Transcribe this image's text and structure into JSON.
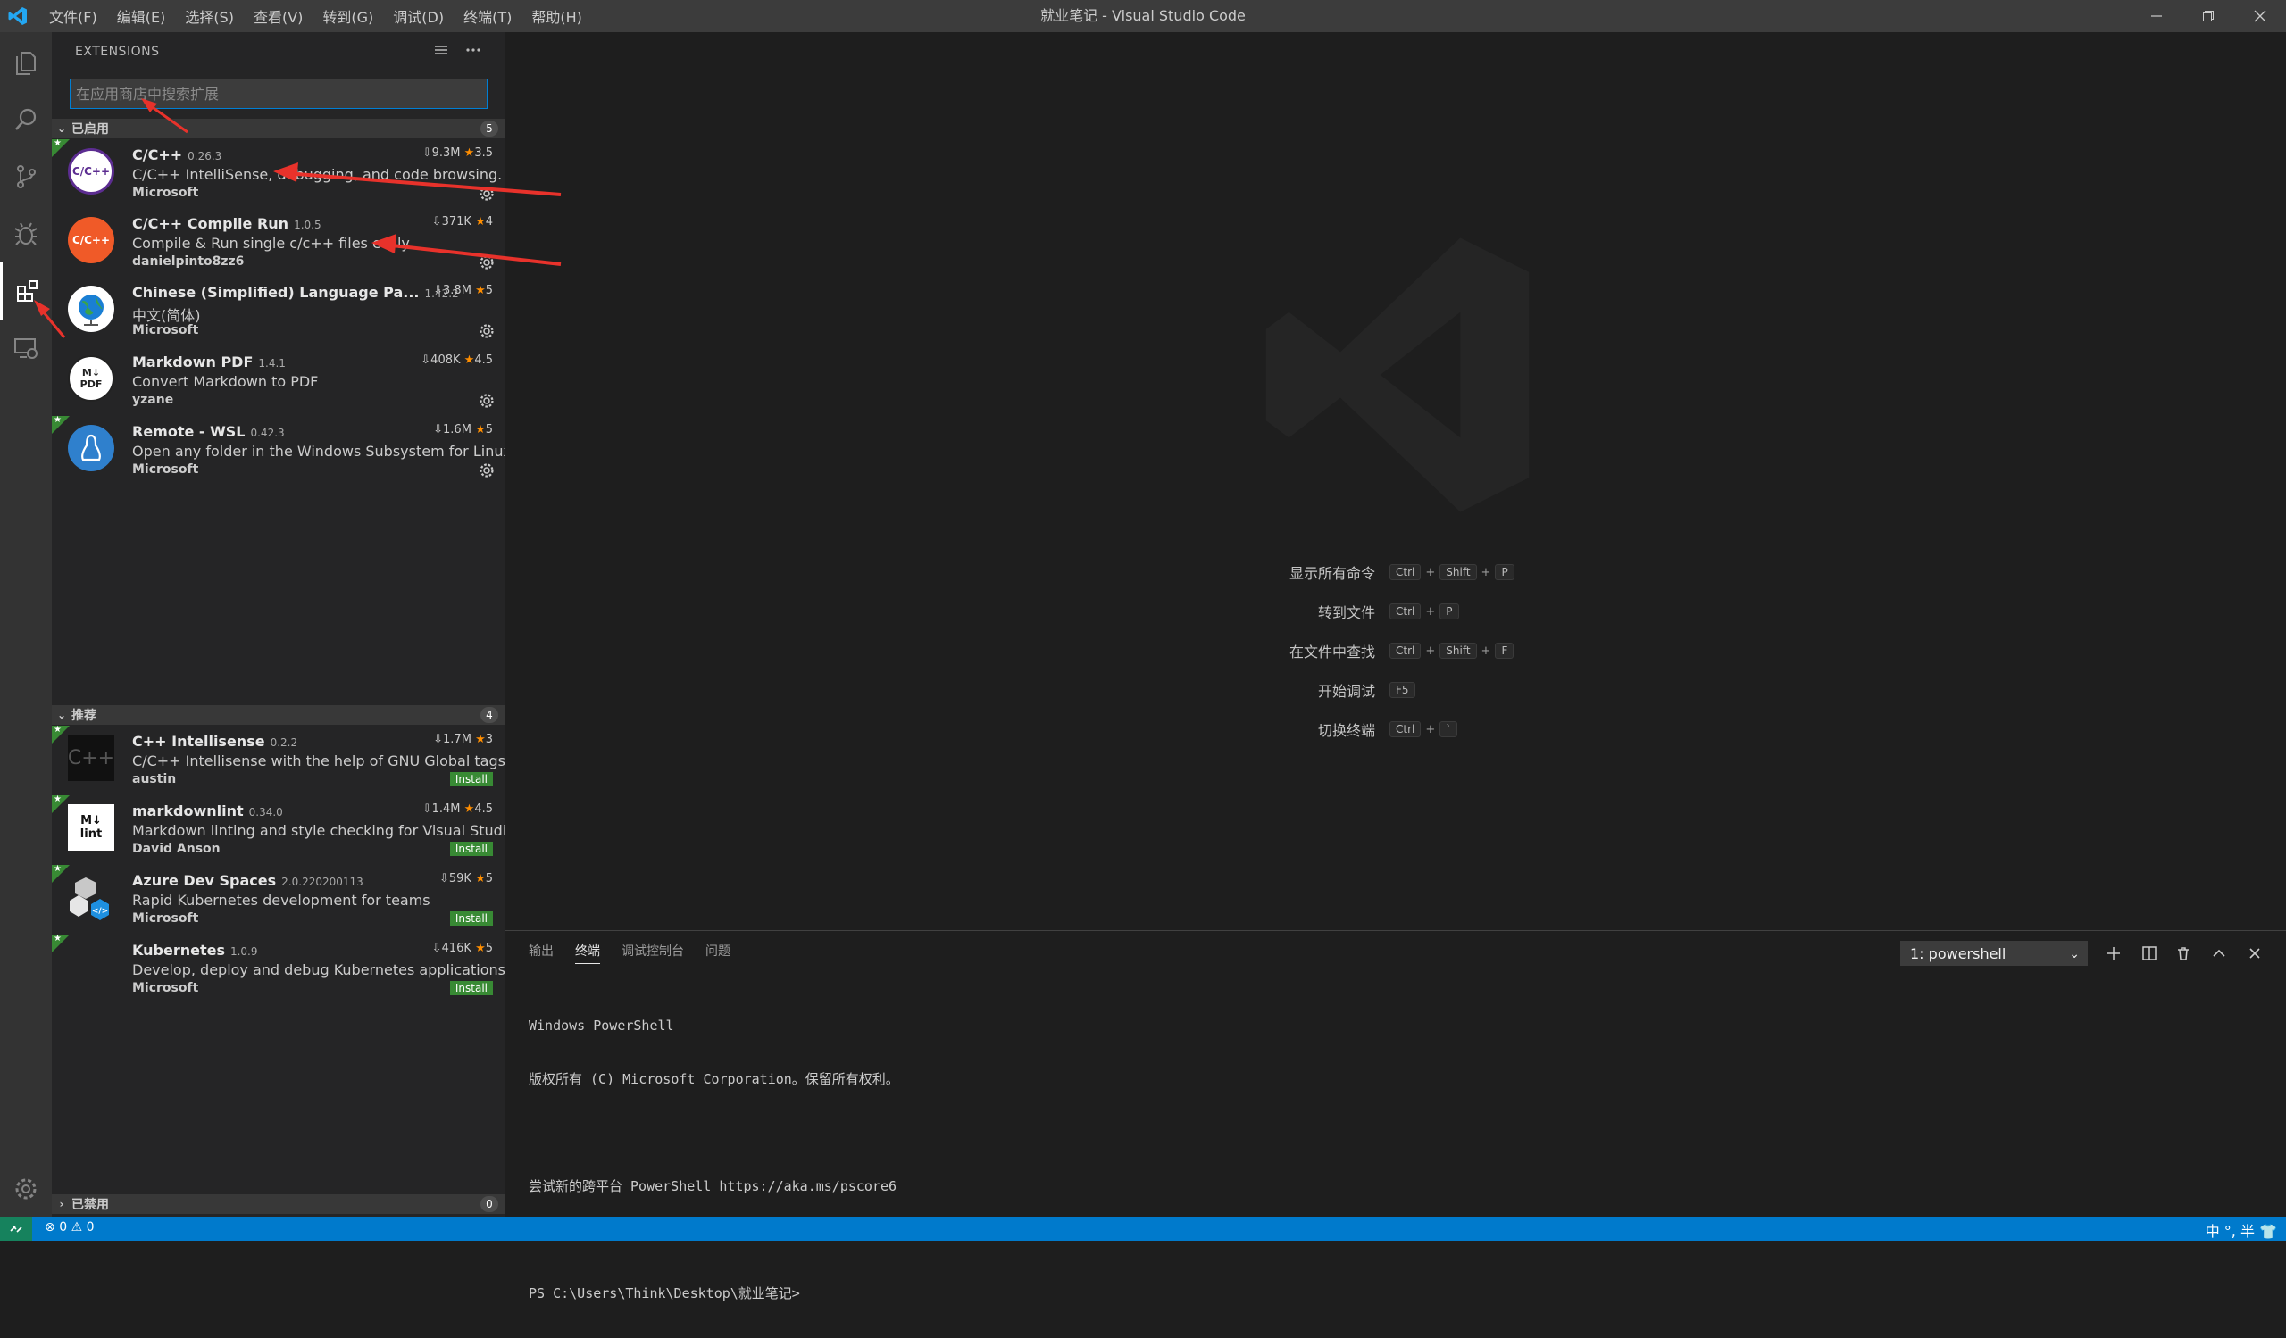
{
  "window": {
    "title": "就业笔记 - Visual Studio Code",
    "menu": [
      "文件(F)",
      "编辑(E)",
      "选择(S)",
      "查看(V)",
      "转到(G)",
      "调试(D)",
      "终端(T)",
      "帮助(H)"
    ]
  },
  "sidebar": {
    "title": "EXTENSIONS",
    "search_placeholder": "在应用商店中搜索扩展",
    "enabled_section": {
      "label": "已启用",
      "count": "5"
    },
    "recommended_section": {
      "label": "推荐",
      "count": "4"
    },
    "disabled_section": {
      "label": "已禁用",
      "count": "0"
    },
    "enabled": [
      {
        "name": "C/C++",
        "version": "0.26.3",
        "downloads": "9.3M",
        "rating": "3.5",
        "description": "C/C++ IntelliSense, debugging, and code browsing.",
        "publisher": "Microsoft",
        "icon_text": "C/C++",
        "icon_color": "#5c2d91"
      },
      {
        "name": "C/C++ Compile Run",
        "version": "1.0.5",
        "downloads": "371K",
        "rating": "4",
        "description": "Compile & Run single c/c++ files easly",
        "publisher": "danielpinto8zz6",
        "icon_text": "C/C++",
        "icon_color": "#f05a28"
      },
      {
        "name": "Chinese (Simplified) Language Pa...",
        "version": "1.42.2",
        "downloads": "3.8M",
        "rating": "5",
        "description": "中文(简体)",
        "publisher": "Microsoft",
        "icon_text": "globe",
        "icon_color": "#1a7fd4"
      },
      {
        "name": "Markdown PDF",
        "version": "1.4.1",
        "downloads": "408K",
        "rating": "4.5",
        "description": "Convert Markdown to PDF",
        "publisher": "yzane",
        "icon_text": "M↓ PDF",
        "icon_color": "#ffffff"
      },
      {
        "name": "Remote - WSL",
        "version": "0.42.3",
        "downloads": "1.6M",
        "rating": "5",
        "description": "Open any folder in the Windows Subsystem for Linux (...",
        "publisher": "Microsoft",
        "icon_text": "linux",
        "icon_color": "#2f80cd"
      }
    ],
    "recommended": [
      {
        "name": "C++ Intellisense",
        "version": "0.2.2",
        "downloads": "1.7M",
        "rating": "3",
        "description": "C/C++ Intellisense with the help of GNU Global tags",
        "publisher": "austin",
        "icon_text": "C++",
        "install": "Install"
      },
      {
        "name": "markdownlint",
        "version": "0.34.0",
        "downloads": "1.4M",
        "rating": "4.5",
        "description": "Markdown linting and style checking for Visual Studio ...",
        "publisher": "David Anson",
        "icon_text": "M↓ lint",
        "install": "Install"
      },
      {
        "name": "Azure Dev Spaces",
        "version": "2.0.220200113",
        "downloads": "59K",
        "rating": "5",
        "description": "Rapid Kubernetes development for teams",
        "publisher": "Microsoft",
        "icon_text": "cubes",
        "install": "Install"
      },
      {
        "name": "Kubernetes",
        "version": "1.0.9",
        "downloads": "416K",
        "rating": "5",
        "description": "Develop, deploy and debug Kubernetes applications",
        "publisher": "Microsoft",
        "icon_text": "",
        "install": "Install"
      }
    ]
  },
  "editor": {
    "shortcuts": [
      {
        "label": "显示所有命令",
        "keys": [
          "Ctrl",
          "Shift",
          "P"
        ]
      },
      {
        "label": "转到文件",
        "keys": [
          "Ctrl",
          "P"
        ]
      },
      {
        "label": "在文件中查找",
        "keys": [
          "Ctrl",
          "Shift",
          "F"
        ]
      },
      {
        "label": "开始调试",
        "keys": [
          "F5"
        ]
      },
      {
        "label": "切换终端",
        "keys": [
          "Ctrl",
          "`"
        ]
      }
    ]
  },
  "panel": {
    "tabs": [
      "输出",
      "终端",
      "调试控制台",
      "问题"
    ],
    "active_tab": "终端",
    "terminal_select": "1: powershell",
    "terminal_lines": [
      "Windows PowerShell",
      "版权所有 (C) Microsoft Corporation。保留所有权利。",
      "",
      "尝试新的跨平台 PowerShell https://aka.ms/pscore6",
      "",
      "PS C:\\Users\\Think\\Desktop\\就业笔记>"
    ]
  },
  "statusbar": {
    "errors": "0",
    "warnings": "0",
    "ime": "中 °, 半"
  },
  "colors": {
    "accent": "#007acc",
    "star": "#ff8e00",
    "install": "#388a34",
    "annotation_arrow": "#e8322b"
  }
}
